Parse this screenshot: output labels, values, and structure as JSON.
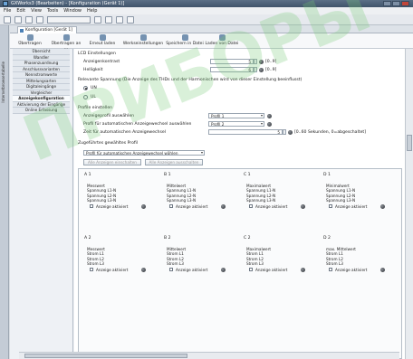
{
  "window": {
    "title": "GXWorks3 (Bearbeiten) - [Konfiguration (Gerät 1)]"
  },
  "menu": [
    "File",
    "Edit",
    "View",
    "Tools",
    "Window",
    "Help"
  ],
  "toolbar": {
    "combo_value": ""
  },
  "side_panel_label": "Internetbrowsertabelle",
  "editor_tab": {
    "label": "Konfiguration [Gerät 1]"
  },
  "page_toolbar": [
    "Übertragen",
    "Übertragen an ...",
    "Erneut laden",
    "Werkseinstellungen",
    "Speichern in Datei",
    "Laden von Datei"
  ],
  "nav": [
    {
      "label": "Übersicht",
      "selected": false
    },
    {
      "label": "Wandler",
      "selected": false
    },
    {
      "label": "Phasenzuordnung",
      "selected": false
    },
    {
      "label": "Anschlussvarianten",
      "selected": false
    },
    {
      "label": "Nennstromwerte",
      "selected": false
    },
    {
      "label": "Mittelungsarten",
      "selected": false
    },
    {
      "label": "Digitaleingänge",
      "selected": false
    },
    {
      "label": "Vergleicher",
      "selected": false
    },
    {
      "label": "Anzeigekonfiguration",
      "selected": true
    },
    {
      "label": "Aktivierung der Eingänge",
      "selected": false
    },
    {
      "label": "Online Erfassung",
      "selected": false
    }
  ],
  "lcd": {
    "section": "LCD Einstellungen",
    "contrast_label": "Anzeigenkontrast",
    "contrast_value": "5",
    "contrast_range": "[0..9]",
    "brightness_label": "Helligkeit",
    "brightness_value": "6",
    "brightness_range": "[0..9]"
  },
  "voltage": {
    "section": "Relevante Spannung (Die Anzeige des THDs und der Harmonischen wird von dieser Einstellung beeinflusst)",
    "opt1": "UN",
    "opt2": "UL"
  },
  "profiles": {
    "section": "Profile einstellen",
    "profile_label": "Anzeigeprofil auswählen",
    "profile_value": "Profil 1",
    "auto_label": "Profil für automatischen Anzeigewechsel auswählen",
    "auto_value": "Profil 2",
    "time_label": "Zeit für automatischen Anzeigewechsel",
    "time_value": "5",
    "time_range": "[0..60 Sekunden, 0=abgeschaltet]"
  },
  "selected_profile": {
    "section": "Zugeführtes gewähltes Profil",
    "dropdown": "Profil für automatischen Anzeigewechsel wählen",
    "btn_on": "Alle Anzeigen einschalten",
    "btn_off": "Alle Anzeigen ausschalten"
  },
  "panel_cols": [
    "A 1",
    "B 1",
    "C 1",
    "D 1"
  ],
  "panel_cols2": [
    "A 2",
    "B 2",
    "C 2",
    "D 2"
  ],
  "cards_row1": [
    {
      "title": "Messwert",
      "lines": [
        "Spannung L1-N",
        "Spannung L2-N",
        "Spannung L3-N"
      ],
      "chk": "Anzeige aktiviert"
    },
    {
      "title": "Mittelwert",
      "lines": [
        "Spannung L1-N",
        "Spannung L2-N",
        "Spannung L3-N"
      ],
      "chk": "Anzeige aktiviert"
    },
    {
      "title": "Maximalwert",
      "lines": [
        "Spannung L1-N",
        "Spannung L2-N",
        "Spannung L3-N"
      ],
      "chk": "Anzeige aktiviert"
    },
    {
      "title": "Minimalwert",
      "lines": [
        "Spannung L1-N",
        "Spannung L2-N",
        "Spannung L3-N"
      ],
      "chk": "Anzeige aktiviert"
    }
  ],
  "cards_row2": [
    {
      "title": "Messwert",
      "lines": [
        "Strom L1",
        "Strom L2",
        "Strom L3"
      ],
      "chk": "Anzeige aktiviert"
    },
    {
      "title": "Mittelwert",
      "lines": [
        "Strom L1",
        "Strom L2",
        "Strom L3"
      ],
      "chk": "Anzeige aktiviert"
    },
    {
      "title": "Maximalwert",
      "lines": [
        "Strom L1",
        "Strom L2",
        "Strom L3"
      ],
      "chk": "Anzeige aktiviert"
    },
    {
      "title": "max. Mittelwert",
      "lines": [
        "Strom L1",
        "Strom L2",
        "Strom L3"
      ],
      "chk": "Anzeige aktiviert"
    }
  ],
  "watermark": "ПРИБОРЫ"
}
